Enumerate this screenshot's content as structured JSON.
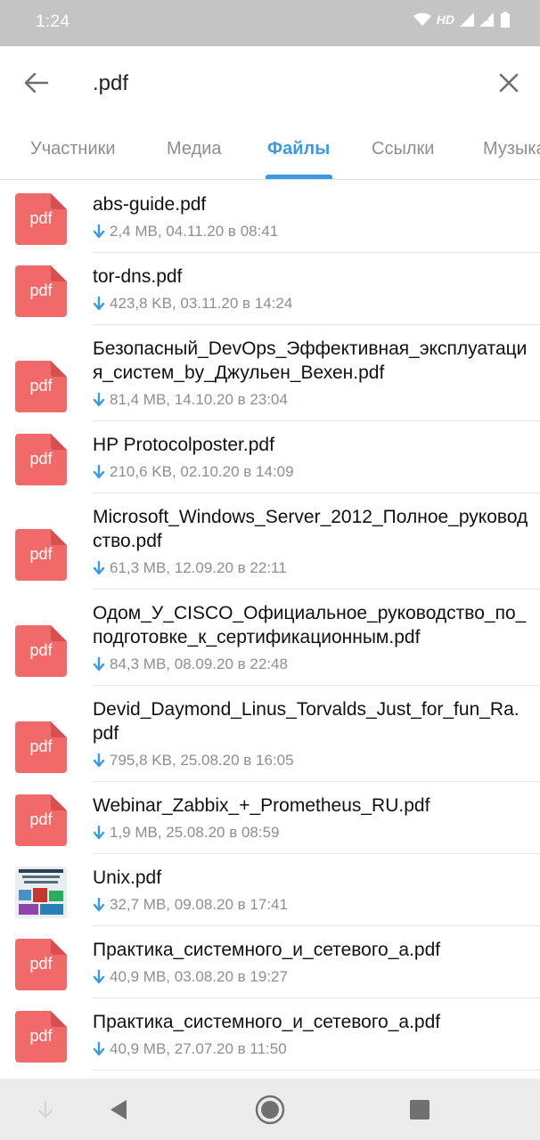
{
  "status_bar": {
    "time": "1:24",
    "network_label": "HD",
    "icons": [
      "wifi-icon",
      "signal-icon",
      "signal-icon",
      "battery-icon"
    ]
  },
  "search": {
    "value": ".pdf",
    "back_icon": "arrow-left-icon",
    "clear_icon": "close-icon"
  },
  "tabs": [
    {
      "label": "Участники",
      "active": false
    },
    {
      "label": "Медиа",
      "active": false
    },
    {
      "label": "Файлы",
      "active": true
    },
    {
      "label": "Ссылки",
      "active": false
    },
    {
      "label": "Музыка",
      "active": false
    }
  ],
  "colors": {
    "accent": "#3b9ae1",
    "pdf_icon": "#f06a6a",
    "meta_text": "#8a8f94",
    "status_bar": "#c4c4c4"
  },
  "files": [
    {
      "name": "abs-guide.pdf",
      "meta": "2,4 MB, 04.11.20 в 08:41",
      "icon": "pdf",
      "icon_label": "pdf"
    },
    {
      "name": "tor-dns.pdf",
      "meta": "423,8 KB, 03.11.20 в 14:24",
      "icon": "pdf",
      "icon_label": "pdf"
    },
    {
      "name": "Безопасный_DevOps_Эффективная_эксплуатация_систем_by_Джульен_Вехен.pdf",
      "meta": "81,4 MB, 14.10.20 в 23:04",
      "icon": "pdf",
      "icon_label": "pdf"
    },
    {
      "name": "HP Protocolposter.pdf",
      "meta": "210,6 KB, 02.10.20 в 14:09",
      "icon": "pdf",
      "icon_label": "pdf"
    },
    {
      "name": "Microsoft_Windows_Server_2012_Полное_руководство.pdf",
      "meta": "61,3 MB, 12.09.20 в 22:11",
      "icon": "pdf",
      "icon_label": "pdf"
    },
    {
      "name": "Одом_У_CISCO_Официальное_руководство_по_подготовке_к_сертификационным.pdf",
      "meta": "84,3 MB, 08.09.20 в 22:48",
      "icon": "pdf",
      "icon_label": "pdf"
    },
    {
      "name": "Devid_Daymond_Linus_Torvalds_Just_for_fun_Ra.pdf",
      "meta": "795,8 KB, 25.08.20 в 16:05",
      "icon": "pdf",
      "icon_label": "pdf"
    },
    {
      "name": "Webinar_Zabbix_+_Prometheus_RU.pdf",
      "meta": "1,9 MB, 25.08.20 в 08:59",
      "icon": "pdf",
      "icon_label": "pdf"
    },
    {
      "name": "Unix.pdf",
      "meta": "32,7 MB, 09.08.20 в 17:41",
      "icon": "thumbnail",
      "icon_label": ""
    },
    {
      "name": "Практика_системного_и_сетевого_а.pdf",
      "meta": "40,9 MB, 03.08.20 в 19:27",
      "icon": "pdf",
      "icon_label": "pdf"
    },
    {
      "name": "Практика_системного_и_сетевого_а.pdf",
      "meta": "40,9 MB, 27.07.20 в 11:50",
      "icon": "pdf",
      "icon_label": "pdf"
    }
  ],
  "nav_bar": {
    "icons": [
      "arrow-down-icon",
      "back-triangle-icon",
      "home-circle-icon",
      "recents-square-icon"
    ]
  }
}
